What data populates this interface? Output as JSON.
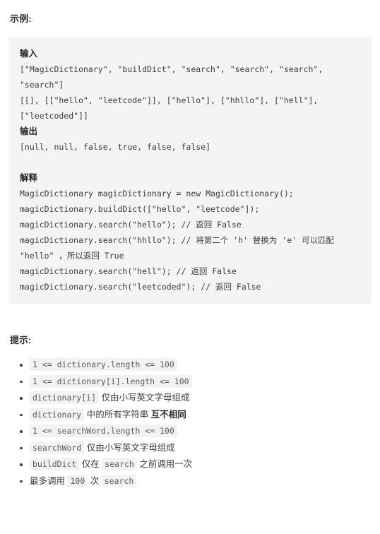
{
  "example": {
    "heading": "示例:",
    "blocks": [
      {
        "kind": "label",
        "text": "输入"
      },
      {
        "kind": "code",
        "text": "[\"MagicDictionary\", \"buildDict\", \"search\", \"search\", \"search\", \"search\"]"
      },
      {
        "kind": "code",
        "text": "[[], [[\"hello\", \"leetcode\"]], [\"hello\"], [\"hhllo\"], [\"hell\"], [\"leetcoded\"]]"
      },
      {
        "kind": "label",
        "text": "输出"
      },
      {
        "kind": "code",
        "text": "[null, null, false, true, false, false]"
      },
      {
        "kind": "blank",
        "text": ""
      },
      {
        "kind": "label",
        "text": "解释"
      },
      {
        "kind": "code",
        "text": "MagicDictionary magicDictionary = new MagicDictionary();"
      },
      {
        "kind": "code",
        "text": "magicDictionary.buildDict([\"hello\", \"leetcode\"]);"
      },
      {
        "kind": "code",
        "text": "magicDictionary.search(\"hello\"); // 返回 False"
      },
      {
        "kind": "code",
        "text": "magicDictionary.search(\"hhllo\"); // 将第二个 'h' 替换为 'e' 可以匹配 \"hello\" ，所以返回 True"
      },
      {
        "kind": "code",
        "text": "magicDictionary.search(\"hell\"); // 返回 False"
      },
      {
        "kind": "code",
        "text": "magicDictionary.search(\"leetcoded\"); // 返回 False"
      }
    ]
  },
  "hints": {
    "heading": "提示:",
    "items": [
      {
        "parts": [
          {
            "type": "code",
            "text": "1 <= dictionary.length <= 100"
          }
        ]
      },
      {
        "parts": [
          {
            "type": "code",
            "text": "1 <= dictionary[i].length <= 100"
          }
        ]
      },
      {
        "parts": [
          {
            "type": "code",
            "text": "dictionary[i]"
          },
          {
            "type": "text",
            "text": " 仅由小写英文字母组成"
          }
        ]
      },
      {
        "parts": [
          {
            "type": "code",
            "text": "dictionary"
          },
          {
            "type": "text",
            "text": " 中的所有字符串 "
          },
          {
            "type": "bold",
            "text": "互不相同"
          }
        ]
      },
      {
        "parts": [
          {
            "type": "code",
            "text": "1 <= searchWord.length <= 100"
          }
        ]
      },
      {
        "parts": [
          {
            "type": "code",
            "text": "searchWord"
          },
          {
            "type": "text",
            "text": " 仅由小写英文字母组成"
          }
        ]
      },
      {
        "parts": [
          {
            "type": "code",
            "text": "buildDict"
          },
          {
            "type": "text",
            "text": " 仅在 "
          },
          {
            "type": "code",
            "text": "search"
          },
          {
            "type": "text",
            "text": " 之前调用一次"
          }
        ]
      },
      {
        "parts": [
          {
            "type": "text",
            "text": "最多调用 "
          },
          {
            "type": "code",
            "text": "100"
          },
          {
            "type": "text",
            "text": " 次 "
          },
          {
            "type": "code",
            "text": "search"
          }
        ]
      }
    ]
  },
  "colors": {
    "codeblock_bg": "#f3f4f5",
    "inline_code_bg": "#f2f2f2",
    "text": "#3c3c3c",
    "heading": "#2c2c2c"
  }
}
